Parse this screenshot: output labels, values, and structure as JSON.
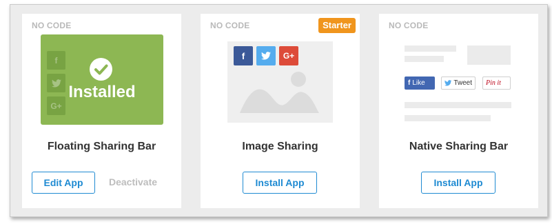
{
  "cards": [
    {
      "tag": "NO CODE",
      "title": "Floating Sharing Bar",
      "preview_status": "Installed",
      "ghost_icons": [
        "f",
        "",
        "G+"
      ],
      "primary_button": "Edit App",
      "secondary_button": "Deactivate"
    },
    {
      "tag": "NO CODE",
      "badge": "Starter",
      "title": "Image Sharing",
      "share_icons": [
        "f",
        "",
        "G+"
      ],
      "primary_button": "Install App"
    },
    {
      "tag": "NO CODE",
      "title": "Native Sharing Bar",
      "native_buttons": [
        "Like",
        "Tweet",
        "Pin it"
      ],
      "primary_button": "Install App"
    }
  ],
  "colors": {
    "accent": "#1e8ad2",
    "installed_green": "#8db753",
    "badge_orange": "#f0951d",
    "facebook": "#3b5998",
    "twitter": "#55acee",
    "google_plus": "#dd4b39"
  }
}
